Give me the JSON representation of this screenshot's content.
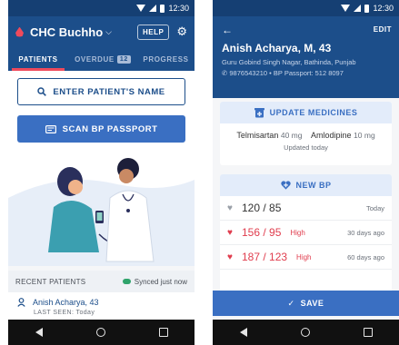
{
  "left": {
    "status": {
      "time": "12:30"
    },
    "appbar": {
      "facility": "CHC Buchho",
      "help_label": "HELP"
    },
    "tabs": {
      "patients": "PATIENTS",
      "overdue": "OVERDUE",
      "overdue_count": "12",
      "progress": "PROGRESS"
    },
    "search_button": "ENTER PATIENT'S NAME",
    "scan_button": "SCAN BP PASSPORT",
    "recent": {
      "header": "RECENT PATIENTS",
      "sync_status": "Synced just now",
      "items": [
        {
          "name": "Anish Acharya, 43",
          "last_seen": "LAST SEEN: Today"
        }
      ]
    }
  },
  "right": {
    "status": {
      "time": "12:30"
    },
    "header": {
      "edit_label": "EDIT",
      "patient_name": "Anish Acharya, M, 43",
      "address": "Guru Gobind Singh Nagar, Bathinda, Punjab",
      "phone_line": "9876543210  •  BP Passport: 512 8097"
    },
    "medicines": {
      "button": "UPDATE MEDICINES",
      "drugs": [
        {
          "name": "Telmisartan",
          "dose": "40 mg"
        },
        {
          "name": "Amlodipine",
          "dose": "10 mg"
        }
      ],
      "updated": "Updated today"
    },
    "bp": {
      "button": "NEW BP",
      "readings": [
        {
          "value": "120 / 85",
          "level": "",
          "date": "Today",
          "high": false
        },
        {
          "value": "156 / 95",
          "level": "High",
          "date": "30 days ago",
          "high": true
        },
        {
          "value": "187 / 123",
          "level": "High",
          "date": "60 days ago",
          "high": true
        }
      ]
    },
    "save_label": "SAVE"
  },
  "colors": {
    "primary": "#1c4e8a",
    "accent_blue": "#3a6fc2",
    "alert_red": "#e03d4e",
    "sync_green": "#2fa36b"
  }
}
